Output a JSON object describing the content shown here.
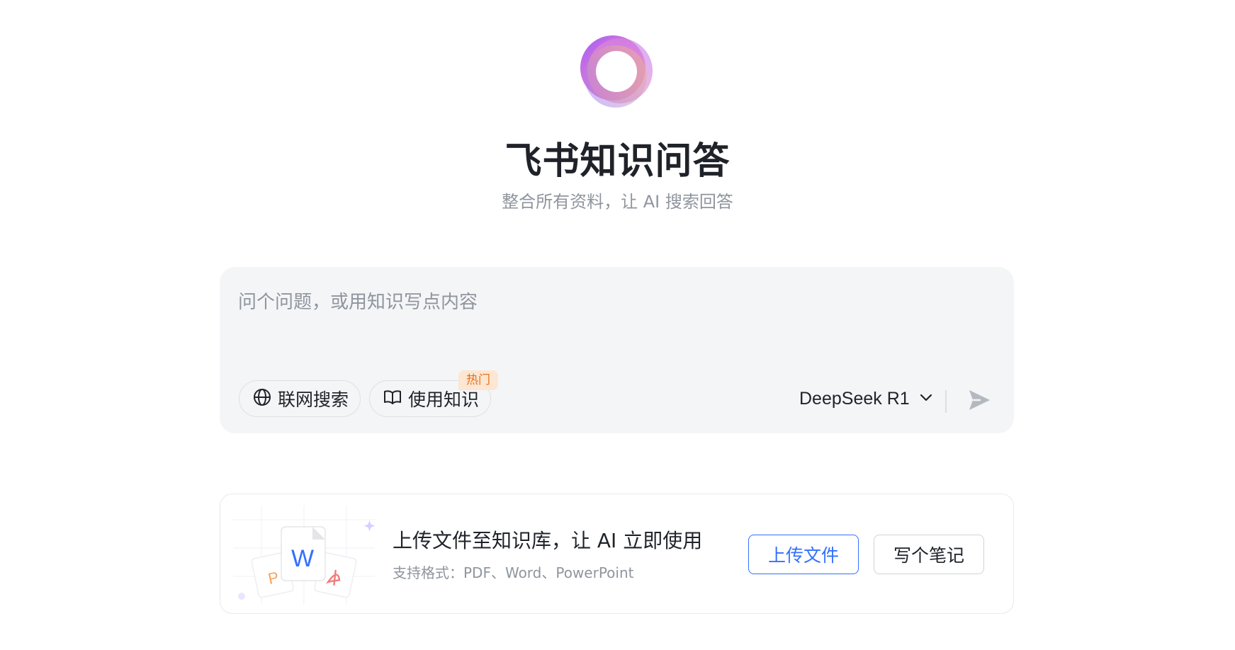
{
  "header": {
    "title": "飞书知识问答",
    "subtitle": "整合所有资料，让 AI 搜索回答",
    "logo_icon": "gradient-ring-logo"
  },
  "ask_box": {
    "placeholder": "问个问题，或用知识写点内容",
    "value": "",
    "web_search_label": "联网搜索",
    "web_search_icon": "globe-icon",
    "knowledge_label": "使用知识",
    "knowledge_icon": "book-icon",
    "hot_badge": "热门",
    "model_label": "DeepSeek R1",
    "model_dropdown_icon": "chevron-down-icon",
    "send_icon": "send-icon"
  },
  "upload_card": {
    "title": "上传文件至知识库，让 AI 立即使用",
    "description": "支持格式：PDF、Word、PowerPoint",
    "upload_button": "上传文件",
    "note_button": "写个笔记",
    "word_glyph": "W",
    "ppt_glyph": "P"
  },
  "colors": {
    "accent": "#3370ff",
    "hot_badge_bg": "#fde6d2",
    "hot_badge_text": "#e5711e",
    "ask_box_bg": "#f4f5f7",
    "muted_text": "#8f959e"
  }
}
